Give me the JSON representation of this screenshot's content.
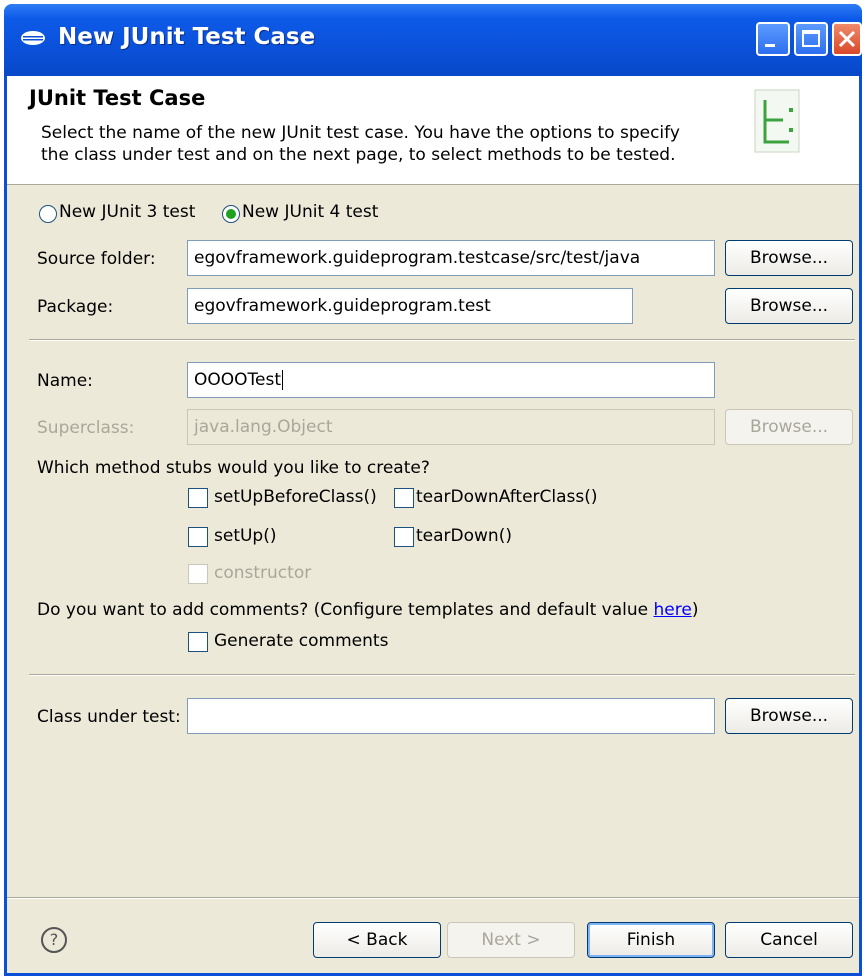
{
  "window": {
    "title": "New JUnit Test Case",
    "colors": {
      "titlebar": "#0a4fd6",
      "dialog_bg": "#ece9d8",
      "radio_selected": "#21a121",
      "link": "#0000ff"
    }
  },
  "banner": {
    "title": "JUnit Test Case",
    "description": "Select the name of the new JUnit test case. You have the options to specify the class under test and on the next page, to select methods to be tested.",
    "icon": "junit-wizard-icon"
  },
  "test_version": {
    "options": [
      {
        "label": "New JUnit 3 test",
        "selected": false
      },
      {
        "label": "New JUnit 4 test",
        "selected": true
      }
    ]
  },
  "source_folder": {
    "label": "Source folder:",
    "value": "egovframework.guideprogram.testcase/src/test/java",
    "browse": "Browse..."
  },
  "package": {
    "label": "Package:",
    "value": "egovframework.guideprogram.test",
    "browse": "Browse..."
  },
  "name": {
    "label": "Name:",
    "value": "OOOOTest"
  },
  "superclass": {
    "label": "Superclass:",
    "value": "java.lang.Object",
    "browse": "Browse...",
    "enabled": false
  },
  "stubs": {
    "question": "Which method stubs would you like to create?",
    "options": [
      {
        "label": "setUpBeforeClass()",
        "checked": false,
        "enabled": true
      },
      {
        "label": "tearDownAfterClass()",
        "checked": false,
        "enabled": true
      },
      {
        "label": "setUp()",
        "checked": false,
        "enabled": true
      },
      {
        "label": "tearDown()",
        "checked": false,
        "enabled": true
      },
      {
        "label": "constructor",
        "checked": false,
        "enabled": false
      }
    ]
  },
  "comments": {
    "question_prefix": "Do you want to add comments? (Configure templates and default value ",
    "link_text": "here",
    "question_suffix": ")",
    "option": {
      "label": "Generate comments",
      "checked": false
    }
  },
  "class_under_test": {
    "label": "Class under test:",
    "value": "",
    "browse": "Browse..."
  },
  "footer": {
    "help_icon": "help-icon",
    "back": "< Back",
    "next": "Next >",
    "finish": "Finish",
    "cancel": "Cancel"
  }
}
